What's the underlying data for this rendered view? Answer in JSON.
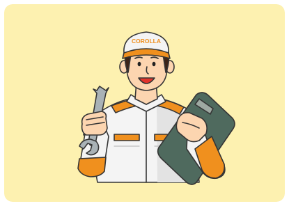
{
  "illustration": {
    "cap_logo_text": "COROLLA",
    "colors": {
      "card_background": "#fdf1b0",
      "brand_orange": "#f0901e",
      "uniform_white": "#f4f4f4",
      "uniform_gray": "#dcdcdc",
      "skin": "#fcd5b0",
      "hair": "#3d2418",
      "clipboard": "#4f6a5e",
      "clipboard_clip": "#9ea9a2",
      "wrench": "#a9b2b6",
      "outline": "#353535",
      "mouth": "#e2332c"
    },
    "icons": [
      "mechanic-figure",
      "cap-icon",
      "wrench-icon",
      "clipboard-icon"
    ]
  }
}
